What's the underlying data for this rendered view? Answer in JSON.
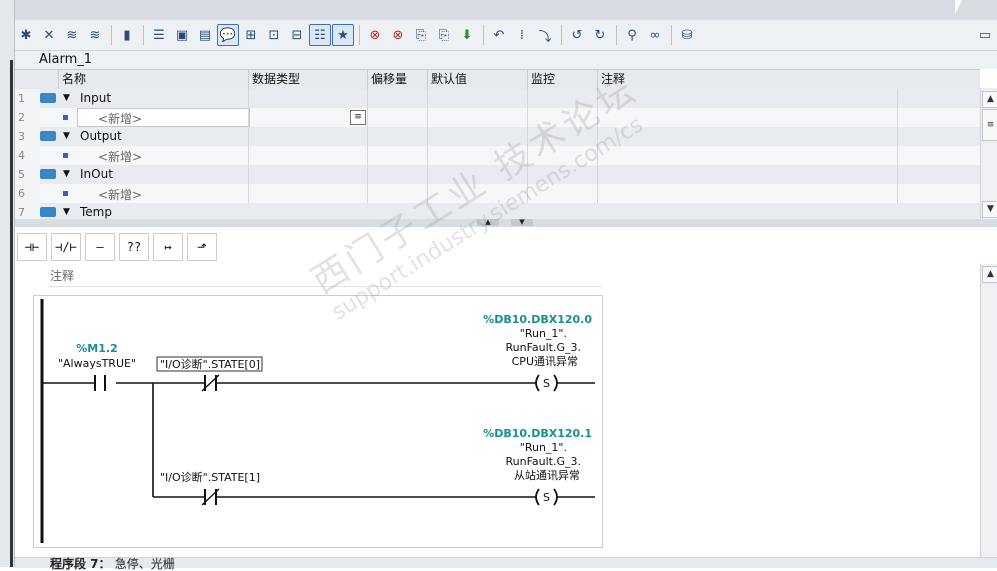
{
  "block": {
    "title": "Alarm_1"
  },
  "table": {
    "headers": [
      "名称",
      "数据类型",
      "偏移量",
      "默认值",
      "监控",
      "注释"
    ],
    "rows": [
      {
        "num": "1",
        "name": "Input"
      },
      {
        "num": "2",
        "name": "<新增>"
      },
      {
        "num": "3",
        "name": "Output"
      },
      {
        "num": "4",
        "name": "<新增>"
      },
      {
        "num": "5",
        "name": "InOut"
      },
      {
        "num": "6",
        "name": "<新增>"
      },
      {
        "num": "7",
        "name": "Temp"
      }
    ]
  },
  "network": {
    "comment": "注释",
    "contact1": {
      "address": "%M1.2",
      "name": "\"AlwaysTRUE\""
    },
    "contact2": {
      "name": "\"I/O诊断\".STATE[0]"
    },
    "contact3": {
      "name": "\"I/O诊断\".STATE[1]"
    },
    "coil1": {
      "address": "%DB10.DBX120.0",
      "line1": "\"Run_1\".",
      "line2": "RunFault.G_3.",
      "line3": "CPU通讯异常",
      "symbol": "S"
    },
    "coil2": {
      "address": "%DB10.DBX120.1",
      "line1": "\"Run_1\".",
      "line2": "RunFault.G_3.",
      "line3": "从站通讯异常",
      "symbol": "S"
    }
  },
  "next_network": {
    "label": "程序段 7：",
    "comment": "急停、光栅"
  },
  "watermark": {
    "line1": "西门子工业 技术论坛",
    "line2": "support.industry.siemens.com/cs"
  },
  "colors": {
    "address": "#1a8f8f",
    "accent": "#3a86c8"
  }
}
